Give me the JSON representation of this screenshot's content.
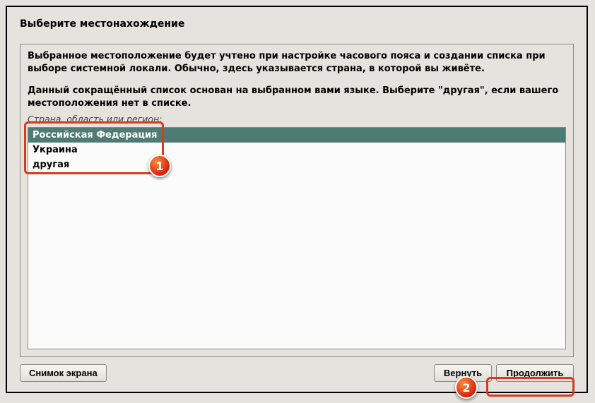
{
  "title": "Выберите местонахождение",
  "info1": "Выбранное местоположение будет учтено при настройке часового пояса и создании списка при выборе системной локали. Обычно, здесь указывается страна, в которой вы живёте.",
  "info2": "Данный сокращённый список основан на выбранном вами языке. Выберите \"другая\", если вашего местоположения нет в списке.",
  "list_label": "Страна, область или регион:",
  "countries": {
    "items": [
      "Российская Федерация",
      "Украина",
      "другая"
    ],
    "selected_index": 0
  },
  "buttons": {
    "screenshot": "Снимок экрана",
    "back": "Вернуть",
    "continue": "Продолжить"
  },
  "annotations": {
    "badge1": "1",
    "badge2": "2"
  }
}
